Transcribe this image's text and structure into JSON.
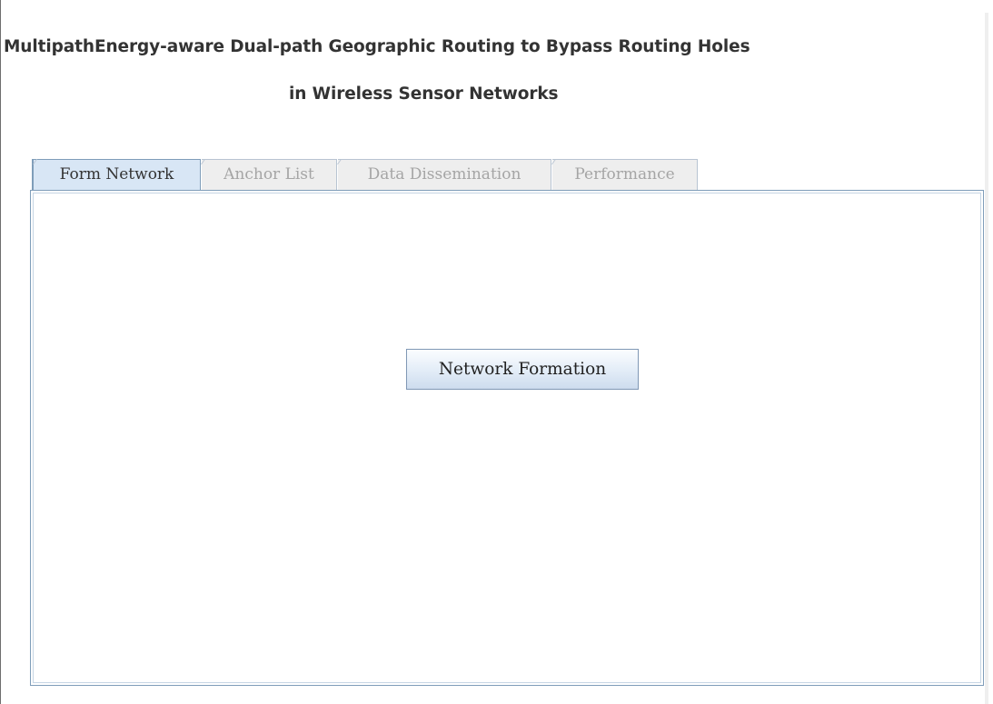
{
  "header": {
    "title_line_1": "MultipathEnergy-aware Dual-path Geographic Routing to Bypass Routing Holes",
    "title_line_2": "in Wireless Sensor Networks"
  },
  "tabs": [
    {
      "label": "Form Network",
      "selected": true
    },
    {
      "label": "Anchor List",
      "selected": false
    },
    {
      "label": "Data Dissemination",
      "selected": false
    },
    {
      "label": "Performance",
      "selected": false
    }
  ],
  "main": {
    "network_formation_button": "Network Formation"
  },
  "colors": {
    "selected_tab_bg": "#d8e6f5",
    "tab_border": "#7f9db9",
    "title_text": "#333333"
  }
}
